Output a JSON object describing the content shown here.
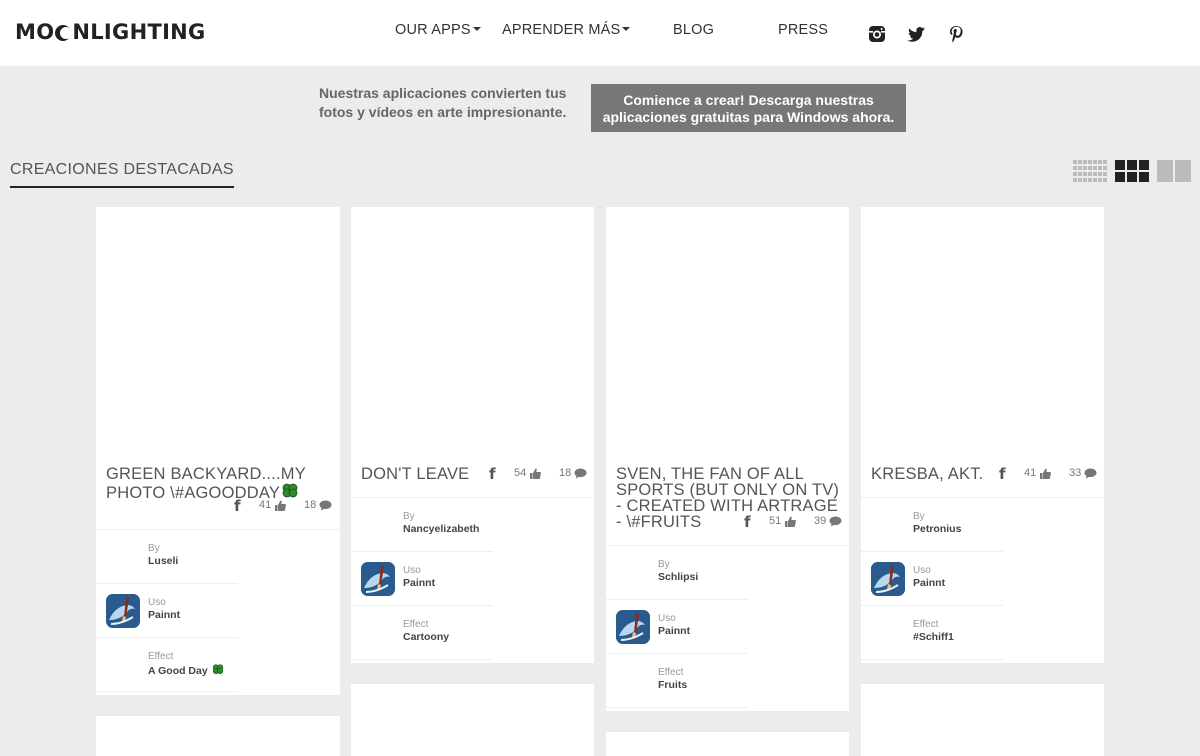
{
  "header": {
    "logo": {
      "pre": "MO",
      "post": "NLIGHTING"
    },
    "nav": [
      {
        "label": "OUR APPS",
        "dropdown": true
      },
      {
        "label": "APRENDER MÁS",
        "dropdown": true
      },
      {
        "label": "BLOG",
        "dropdown": false
      },
      {
        "label": "PRESS",
        "dropdown": false
      }
    ],
    "social": [
      "instagram-icon",
      "twitter-icon",
      "pinterest-icon"
    ]
  },
  "promo": {
    "text": "Nuestras aplicaciones convierten tus fotos y vídeos en arte impresionante.",
    "cta": "Comience a crear! Descarga nuestras aplicaciones gratuitas para Windows ahora."
  },
  "section": {
    "title": "CREACIONES DESTACADAS"
  },
  "layout_options": [
    "grid-small-icon",
    "grid-medium-icon",
    "grid-large-icon"
  ],
  "cards": [
    {
      "title": "GREEN BACKYARD....MY PHOTO \\#AGOODDAY",
      "likes": "41",
      "comments": "18",
      "by_label": "By",
      "by": "Luseli",
      "uso_label": "Uso",
      "uso": "Painnt",
      "effect_label": "Effect",
      "effect": "A Good Day"
    },
    {
      "title": "DON'T LEAVE",
      "likes": "54",
      "comments": "18",
      "by_label": "By",
      "by": "Nancyelizabeth",
      "uso_label": "Uso",
      "uso": "Painnt",
      "effect_label": "Effect",
      "effect": "Cartoony"
    },
    {
      "title": "SVEN, THE FAN OF ALL SPORTS (BUT ONLY ON TV) - CREATED WITH ARTRAGE - \\#FRUITS",
      "likes": "51",
      "comments": "39",
      "by_label": "By",
      "by": "Schlipsi",
      "uso_label": "Uso",
      "uso": "Painnt",
      "effect_label": "Effect",
      "effect": "Fruits"
    },
    {
      "title": "KRESBA, AKT.",
      "likes": "41",
      "comments": "33",
      "by_label": "By",
      "by": "Petronius",
      "uso_label": "Uso",
      "uso": "Painnt",
      "effect_label": "Effect",
      "effect": "#Schiff1"
    }
  ],
  "colors": {
    "background": "#ececec",
    "header": "#ffffff",
    "cta": "#777777",
    "clover": "#2e8b2e",
    "app_icon": "#2a5b8f"
  }
}
